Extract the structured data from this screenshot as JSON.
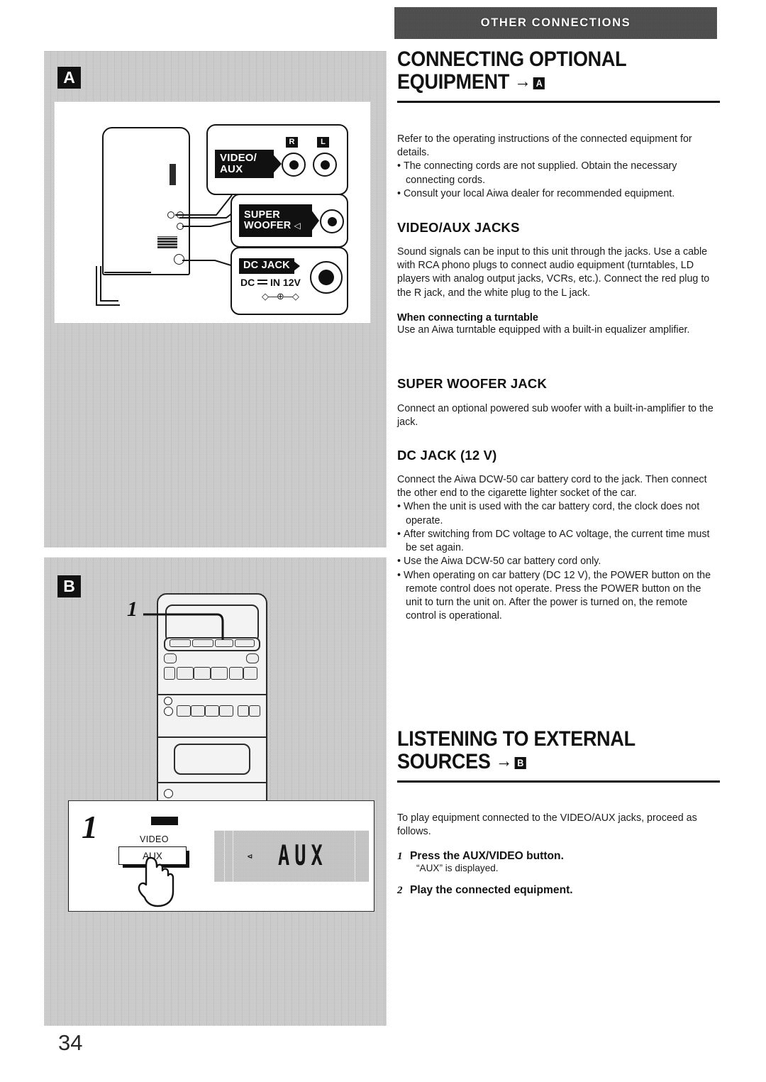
{
  "page": {
    "number": "34"
  },
  "banner": {
    "label": "OTHER CONNECTIONS"
  },
  "headings": {
    "section1_line1": "CONNECTING OPTIONAL",
    "section1_line2": "EQUIPMENT",
    "section1_ref": "A",
    "section2_line1": "LISTENING TO EXTERNAL",
    "section2_line2": "SOURCES",
    "section2_ref": "B",
    "arrow": "→"
  },
  "intro": {
    "paragraph": "Refer to the operating instructions of the connected equipment for details.",
    "bullets": [
      "The connecting cords are not supplied.  Obtain the necessary connecting cords.",
      "Consult your local Aiwa dealer for recommended equipment."
    ]
  },
  "video_aux_jacks": {
    "title": "VIDEO/AUX JACKS",
    "paragraph": "Sound signals can be input to this unit through the jacks. Use a cable with RCA phono plugs to connect audio equipment (turntables, LD players with analog output jacks, VCRs, etc.). Connect the red plug to the R jack, and the white plug to the L jack.",
    "subtitle": "When connecting a turntable",
    "subparagraph": "Use an Aiwa turntable equipped with a built-in equalizer amplifier."
  },
  "super_woofer_jack": {
    "title": "SUPER WOOFER JACK",
    "paragraph": "Connect an optional powered sub woofer with a built-in-amplifier to the jack."
  },
  "dc_jack": {
    "title": "DC JACK (12 V)",
    "paragraph": "Connect the Aiwa DCW-50 car battery cord to the jack. Then connect the other end to the cigarette lighter socket of the car.",
    "bullets": [
      "When the unit is used with the car battery cord, the clock does not operate.",
      "After switching from DC voltage to AC voltage, the current time must be set again.",
      "Use the Aiwa DCW-50 car battery cord only.",
      "When operating on car battery (DC 12 V), the POWER button on the remote control does not operate. Press the POWER button on the unit to turn the unit on. After the power is turned on, the remote control is operational."
    ]
  },
  "listening": {
    "paragraph": "To play equipment connected to the VIDEO/AUX jacks, proceed as follows.",
    "steps": [
      {
        "num": "1",
        "title": "Press the AUX/VIDEO button.",
        "detail": "“AUX” is displayed."
      },
      {
        "num": "2",
        "title": "Play the connected equipment.",
        "detail": ""
      }
    ]
  },
  "figure_a": {
    "tag": "A",
    "video_aux_label_line1": "VIDEO/",
    "video_aux_label_line2": "AUX",
    "jack_r": "R",
    "jack_l": "L",
    "super_woofer_line1": "SUPER",
    "super_woofer_line2": "WOOFER",
    "speaker_glyph": "◁",
    "dc_jack_label": "DC JACK",
    "dc_rating": "DC",
    "dc_rating2": "IN 12V",
    "polarity": "◇—⊕—◇"
  },
  "figure_b": {
    "tag": "B",
    "callout_number": "1"
  },
  "callout": {
    "step_number": "1",
    "button_top_label": "VIDEO",
    "button_label": "AUX",
    "display_text": "AUX"
  }
}
